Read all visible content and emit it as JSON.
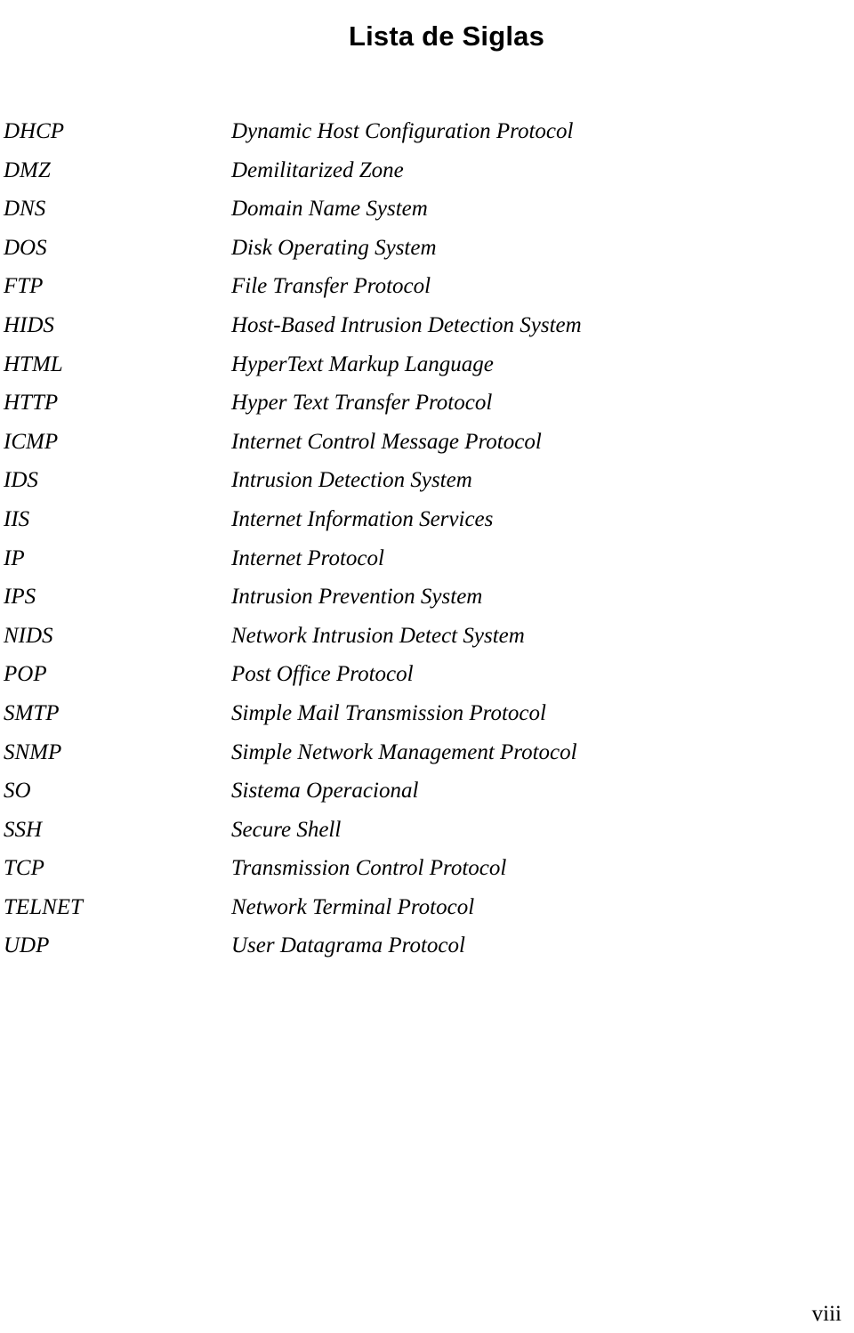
{
  "document": {
    "title": "Lista de Siglas",
    "page_number": "viii",
    "text_color": "#000000",
    "background_color": "#ffffff"
  },
  "acronyms": {
    "rows": [
      {
        "term": "DHCP",
        "definition": "Dynamic Host Configuration Protocol"
      },
      {
        "term": "DMZ",
        "definition": "Demilitarized Zone"
      },
      {
        "term": "DNS",
        "definition": "Domain Name System"
      },
      {
        "term": "DOS",
        "definition": "Disk Operating System"
      },
      {
        "term": "FTP",
        "definition": "File Transfer Protocol"
      },
      {
        "term": "HIDS",
        "definition": "Host-Based Intrusion Detection System"
      },
      {
        "term": "HTML",
        "definition": "HyperText Markup Language"
      },
      {
        "term": "HTTP",
        "definition": "Hyper Text Transfer Protocol"
      },
      {
        "term": "ICMP",
        "definition": "Internet Control Message Protocol"
      },
      {
        "term": "IDS",
        "definition": "Intrusion Detection System"
      },
      {
        "term": "IIS",
        "definition": "Internet Information Services"
      },
      {
        "term": "IP",
        "definition": "Internet Protocol"
      },
      {
        "term": "IPS",
        "definition": "Intrusion Prevention System"
      },
      {
        "term": "NIDS",
        "definition": "Network Intrusion Detect System"
      },
      {
        "term": "POP",
        "definition": "Post Office Protocol"
      },
      {
        "term": "SMTP",
        "definition": "Simple Mail Transmission Protocol"
      },
      {
        "term": "SNMP",
        "definition": "Simple Network Management Protocol"
      },
      {
        "term": "SO",
        "definition": "Sistema Operacional"
      },
      {
        "term": "SSH",
        "definition": "Secure Shell"
      },
      {
        "term": "TCP",
        "definition": "Transmission Control Protocol"
      },
      {
        "term": "TELNET",
        "definition": "Network Terminal Protocol"
      },
      {
        "term": "UDP",
        "definition": "User Datagrama Protocol"
      }
    ]
  }
}
